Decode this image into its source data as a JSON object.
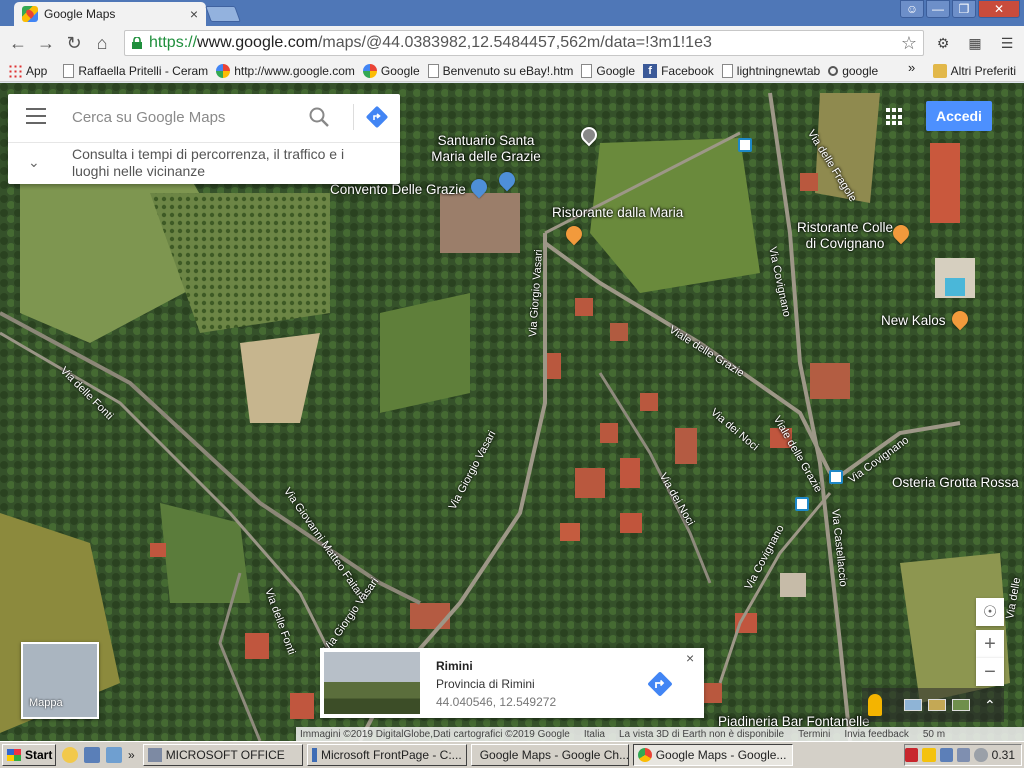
{
  "browser": {
    "tab_title": "Google Maps",
    "tab_close": "×",
    "url_scheme": "https://",
    "url_host": "www.google.com",
    "url_path": "/maps/@44.0383982,12.5484457,562m/data=!3m1!1e3"
  },
  "bookmarks": {
    "items": [
      "App",
      "Raffaella Pritelli - Ceram",
      "http://www.google.com",
      "Google",
      "Benvenuto su eBay!.htm",
      "Google",
      "Facebook",
      "lightningnewtab",
      "google"
    ],
    "more": "»",
    "other": "Altri Preferiti"
  },
  "search": {
    "placeholder": "Cerca su Google Maps",
    "hint": "Consulta i tempi di percorrenza, il traffico e i luoghi nelle vicinanze"
  },
  "header": {
    "signin": "Accedi"
  },
  "map": {
    "poi": [
      "Santuario Santa Maria delle Grazie",
      "Convento Delle Grazie",
      "Ristorante dalla Maria",
      "Ristorante Colle di Covignano",
      "New Kalos",
      "Osteria Grotta Rossa",
      "Piadineria Bar Fontanelle"
    ],
    "streets": [
      "Via delle Fragole",
      "Via Covignano",
      "Via Giorgio Vasari",
      "Viale delle Grazie",
      "Via dei Noci",
      "Via Covignano",
      "Via delle Fonti",
      "Via Giovanni Matteo Faitani",
      "Via delle Fonti",
      "Via Giorgio Vasari",
      "Via Giorgio Vasari",
      "Viale delle Grazie",
      "Via dei Noci",
      "Via Castellaccio",
      "Via Covignano",
      "Via delle"
    ]
  },
  "mappa_tile": {
    "label": "Mappa"
  },
  "info_card": {
    "title": "Rimini",
    "subtitle": "Provincia di Rimini",
    "coords": "44.040546, 12.549272",
    "close": "×"
  },
  "attribution": {
    "imagery": "Immagini ©2019 DigitalGlobe,Dati cartografici ©2019 Google",
    "country": "Italia",
    "vista3d": "La vista 3D di Earth non è disponibile",
    "terms": "Termini",
    "feedback": "Invia feedback",
    "scale": "50 m"
  },
  "taskbar": {
    "start": "Start",
    "more": "»",
    "tasks": [
      "MICROSOFT OFFICE",
      "Microsoft FrontPage - C:...",
      "Google Maps - Google Ch...",
      "Google Maps - Google..."
    ],
    "clock": "0.31"
  },
  "colors": {
    "accent": "#4d90fe",
    "tabbar": "#4f77b7",
    "poi_orange": "#f29a3c",
    "poi_blue": "#4e8fd8"
  }
}
